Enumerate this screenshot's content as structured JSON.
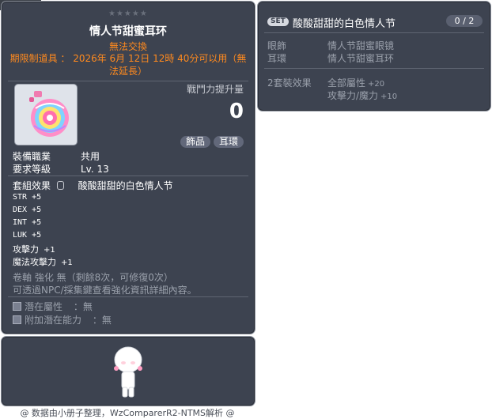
{
  "item_id": "01032182",
  "main": {
    "stars": "★★★★★",
    "title": "情人节甜蜜耳环",
    "trade_note": "無法交換",
    "limited_text": "期限制道具 ： 2026年 6月 12日 12時 40分可以用（無法延長）",
    "atk_increase_label": "戰鬥力提升量",
    "atk_increase_value": "0",
    "tags": [
      "飾品",
      "耳環"
    ],
    "job_label": "裝備職業",
    "job_value": "共用",
    "level_label": "要求等級",
    "level_value": "Lv. 13",
    "set_effect_label": "套組效果",
    "set_effect_value": "酸酸甜甜的白色情人节",
    "stats": [
      {
        "name": "STR",
        "value": "+5"
      },
      {
        "name": "DEX",
        "value": "+5"
      },
      {
        "name": "INT",
        "value": "+5"
      },
      {
        "name": "LUK",
        "value": "+5"
      },
      {
        "name": "攻擊力",
        "value": "+1"
      },
      {
        "name": "魔法攻擊力",
        "value": "+1"
      }
    ],
    "scroll_text": "卷軸 強化 無（剩餘8次，可修復0次）",
    "npc_text": "可透過NPC/採集鍵查看強化資訊詳細內容。",
    "potential_label": "潛在屬性",
    "potential_value": "：無",
    "bonus_potential_label": "附加潛在能力",
    "bonus_potential_value": "：無"
  },
  "set_panel": {
    "badge": "SET",
    "name": "酸酸甜甜的白色情人节",
    "count": "0 / 2",
    "parts": [
      {
        "slot": "眼飾",
        "item": "情人节甜蜜眼镜"
      },
      {
        "slot": "耳環",
        "item": "情人节甜蜜耳环"
      }
    ],
    "effect_label": "2套裝效果",
    "effects": [
      {
        "name": "全部屬性",
        "value": "+20"
      },
      {
        "name": "攻擊力/魔力",
        "value": "+10"
      }
    ]
  },
  "credit": "@ 数据由小册子整理，WzComparerR2-NTMS解析 @"
}
